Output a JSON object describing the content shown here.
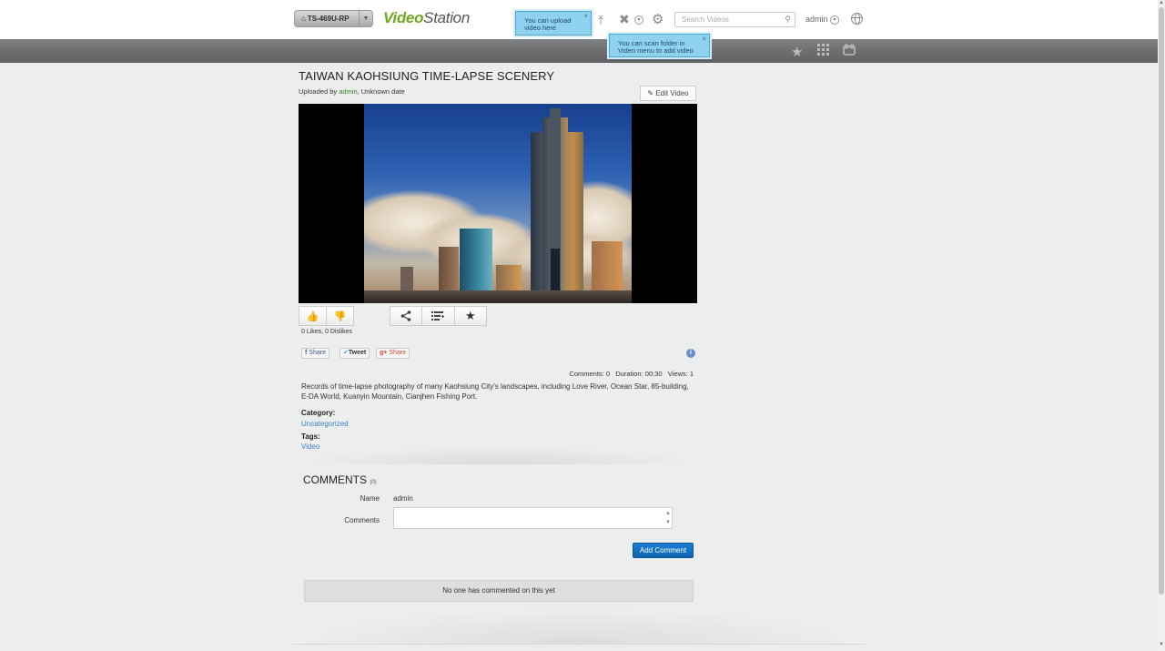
{
  "header": {
    "nas_name": "TS-469U-RP",
    "logo_primary": "Video",
    "logo_secondary": "Station",
    "tip_upload": "You can upload video here",
    "tip_scan": "You can scan folder in Video menu to add video",
    "search_placeholder": "Search Videos",
    "user": "admin"
  },
  "video": {
    "title": "TAIWAN KAOHSIUNG TIME-LAPSE SCENERY",
    "uploaded_prefix": "Uploaded by ",
    "uploader": "admin",
    "uploaded_suffix": ", Unknown date",
    "edit_label": "Edit Video",
    "likes_text": "0 Likes, 0 Dislikes",
    "share_fb": "Share",
    "share_tw": "Tweet",
    "share_gp": "Share",
    "stats": "Comments: 0   Duration: 00:30   Views: 1",
    "description": "Records of time-lapse photography of many Kaohsiung City's landscapes, including Love River, Ocean Star, 85-building, E-DA World, Kuanyin Mountain, Cianjhen Fishing Port.",
    "category_label": "Category:",
    "category": "Uncategorized",
    "tags_label": "Tags:",
    "tag": "Video"
  },
  "comments": {
    "heading": "COMMENTS",
    "count": "(0)",
    "name_label": "Name",
    "name_value": "admin",
    "comments_label": "Comments",
    "add_label": "Add Comment",
    "empty_text": "No one has commented on this yet"
  }
}
